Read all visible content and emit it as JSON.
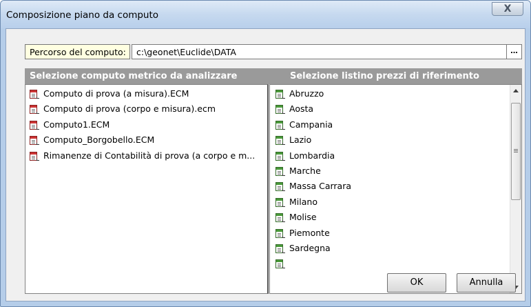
{
  "window": {
    "title": "Composizione piano da computo",
    "close_label": "X"
  },
  "path": {
    "label": "Percorso del computo:",
    "value": "c:\\geonet\\Euclide\\DATA",
    "browse_label": "..."
  },
  "left_panel": {
    "header": "Selezione computo metrico da analizzare",
    "items": [
      {
        "label": "Computo di prova (a misura).ECM"
      },
      {
        "label": "Computo di prova (corpo e misura).ecm"
      },
      {
        "label": "Computo1.ECM"
      },
      {
        "label": "Computo_Borgobello.ECM"
      },
      {
        "label": "Rimanenze di Contabilità di prova (a corpo e m..."
      }
    ]
  },
  "right_panel": {
    "header": "Selezione listino prezzi di riferimento",
    "items": [
      {
        "label": "Abruzzo"
      },
      {
        "label": "Aosta"
      },
      {
        "label": "Campania"
      },
      {
        "label": "Lazio"
      },
      {
        "label": "Lombardia"
      },
      {
        "label": "Marche"
      },
      {
        "label": "Massa Carrara"
      },
      {
        "label": "Milano"
      },
      {
        "label": "Molise"
      },
      {
        "label": "Piemonte"
      },
      {
        "label": "Sardegna"
      }
    ]
  },
  "buttons": {
    "ok": "OK",
    "cancel": "Annulla"
  },
  "icons": {
    "computo_file": "red-document-icon",
    "listino_file": "green-document-icon"
  },
  "colors": {
    "header_bg": "#9a9a9a",
    "label_bg": "#ffffe1",
    "computo_icon": "#cc3333",
    "listino_icon": "#4a9a3a"
  }
}
